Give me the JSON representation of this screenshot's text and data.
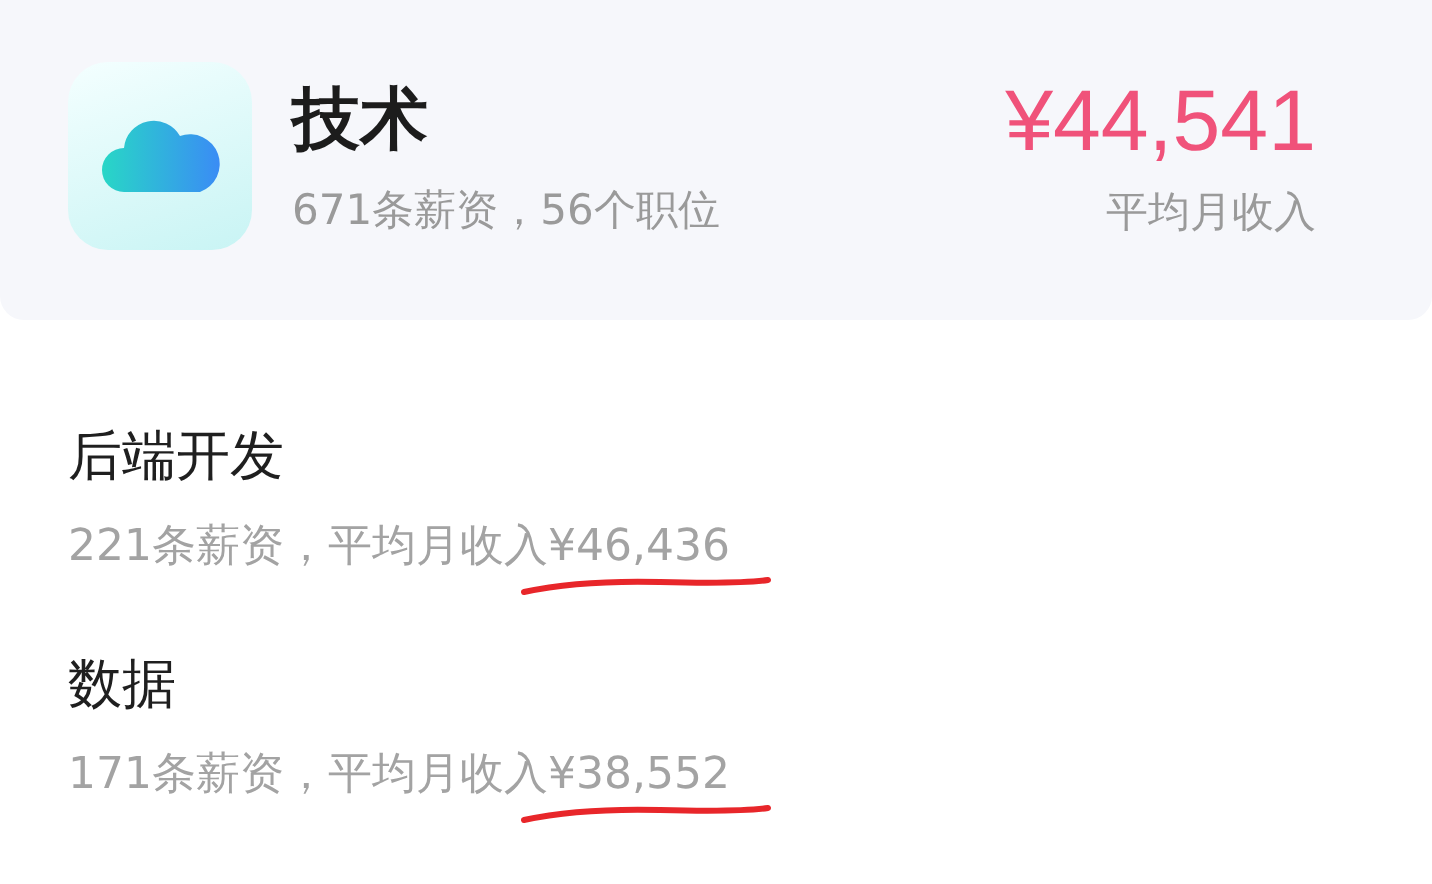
{
  "header": {
    "title": "技术",
    "subtitle": "671条薪资，56个职位",
    "amount": "¥44,541",
    "amount_label": "平均月收入"
  },
  "items": [
    {
      "name": "后端开发",
      "summary": "221条薪资，平均月收入",
      "amount": "¥46,436",
      "underlined": true
    },
    {
      "name": "数据",
      "summary": "171条薪资，平均月收入",
      "amount": "¥38,552",
      "underlined": true
    }
  ]
}
